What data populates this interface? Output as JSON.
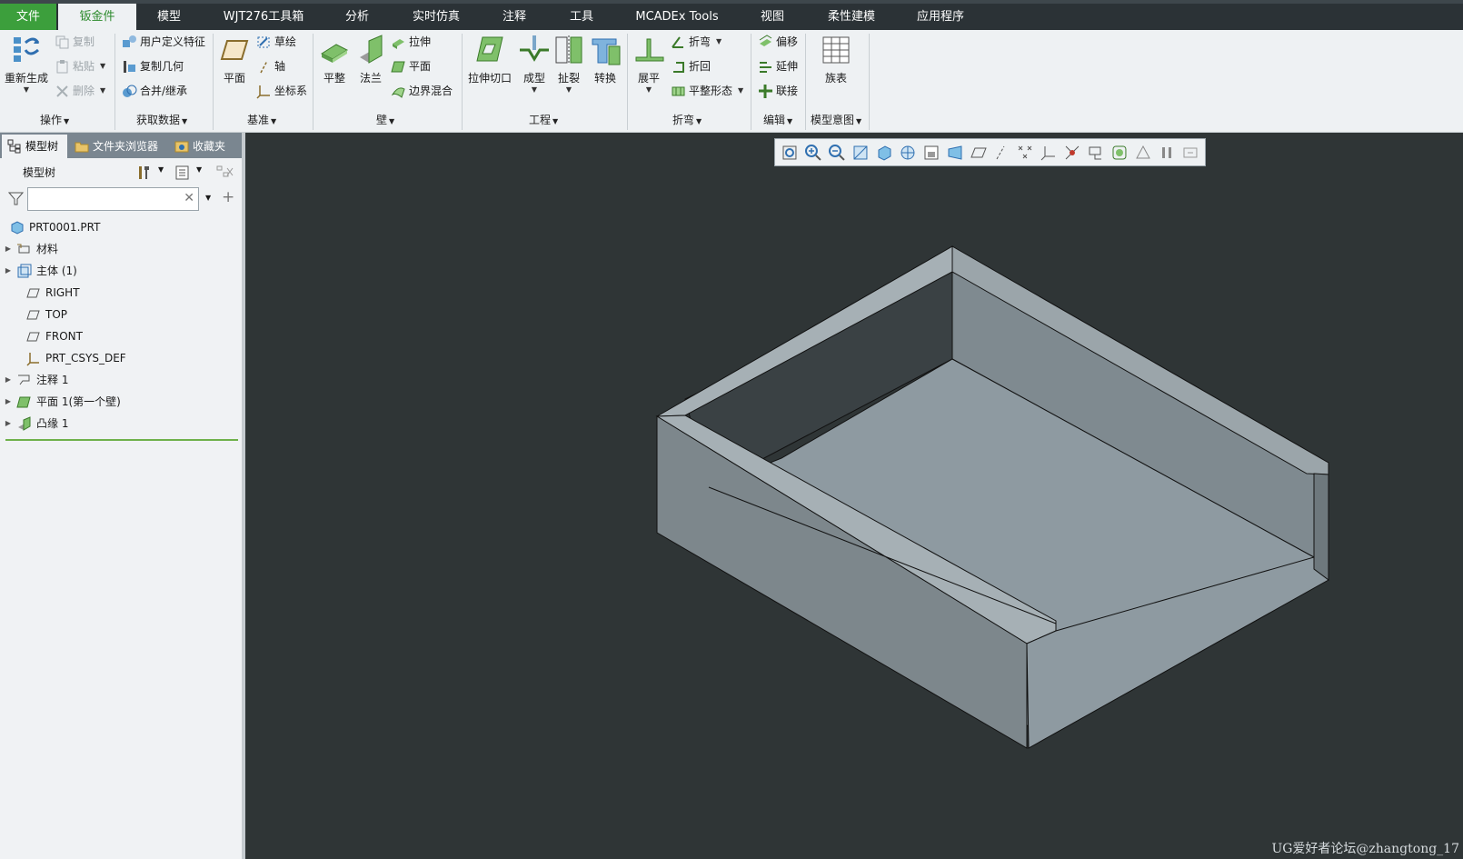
{
  "menu": {
    "tabs": [
      "文件",
      "钣金件",
      "模型",
      "WJT276工具箱",
      "分析",
      "实时仿真",
      "注释",
      "工具",
      "MCADEx Tools",
      "视图",
      "柔性建模",
      "应用程序"
    ],
    "active_tab": "钣金件"
  },
  "ribbon": {
    "operations": {
      "regenerate": "重新生成",
      "copy": "复制",
      "paste": "粘贴",
      "delete": "删除",
      "title": "操作"
    },
    "get_data": {
      "udf": "用户定义特征",
      "copy_geometry": "复制几何",
      "merge_inherit": "合并/继承",
      "title": "获取数据"
    },
    "datum": {
      "plane": "平面",
      "sketch": "草绘",
      "axis": "轴",
      "csys": "坐标系",
      "title": "基准"
    },
    "wall": {
      "flat": "平整",
      "flange": "法兰",
      "extrude": "拉伸",
      "planar": "平面",
      "boundary_blend": "边界混合",
      "title": "壁"
    },
    "engineering": {
      "extrude_cut": "拉伸切口",
      "form": "成型",
      "rip": "扯裂",
      "convert": "转换",
      "title": "工程"
    },
    "bend": {
      "unbend": "展平",
      "bend": "折弯",
      "bend_back": "折回",
      "flat_pattern": "平整形态",
      "title": "折弯"
    },
    "editing": {
      "offset": "偏移",
      "extend": "延伸",
      "join": "联接",
      "title": "编辑"
    },
    "model_intent": {
      "family_table": "族表",
      "title": "模型意图"
    }
  },
  "left_panel": {
    "tabs": [
      "模型树",
      "文件夹浏览器",
      "收藏夹"
    ],
    "tree_title": "模型树",
    "search": {
      "value": "",
      "placeholder": ""
    },
    "items": [
      {
        "label": "PRT0001.PRT",
        "icon": "part-icon",
        "expandable": false
      },
      {
        "label": "材料",
        "icon": "material-icon",
        "expandable": true
      },
      {
        "label": "主体 (1)",
        "icon": "body-icon",
        "expandable": true
      },
      {
        "label": "RIGHT",
        "icon": "datum-plane-icon",
        "expandable": false
      },
      {
        "label": "TOP",
        "icon": "datum-plane-icon",
        "expandable": false
      },
      {
        "label": "FRONT",
        "icon": "datum-plane-icon",
        "expandable": false
      },
      {
        "label": "PRT_CSYS_DEF",
        "icon": "csys-icon",
        "expandable": false
      },
      {
        "label": "注释 1",
        "icon": "annotation-icon",
        "expandable": true
      },
      {
        "label": "平面 1(第一个壁)",
        "icon": "planar-wall-icon",
        "expandable": true
      },
      {
        "label": "凸缘 1",
        "icon": "flange-icon",
        "expandable": true
      }
    ]
  },
  "graphics": {
    "watermark": "UG爱好者论坛@zhangtong_17",
    "view_toolbar_icons": [
      "refit-icon",
      "zoom-in-icon",
      "zoom-out-icon",
      "repaint-icon",
      "display-style-icon",
      "saved-orientations-icon",
      "view-manager-icon",
      "perspective-icon",
      "plane-display-icon",
      "axis-display-icon",
      "point-display-icon",
      "csys-display-icon",
      "spin-center-icon",
      "annotation-display-icon",
      "appearance-icon",
      "simulation-icon",
      "pause-icon",
      "next-icon"
    ]
  },
  "colors": {
    "accent": "#3c9f3c",
    "menubar": "#2b3236",
    "ribbon": "#eef1f3",
    "viewport": "#2f3536",
    "model_face_light": "#8e9aa1",
    "model_face_dark": "#7f8a90"
  }
}
